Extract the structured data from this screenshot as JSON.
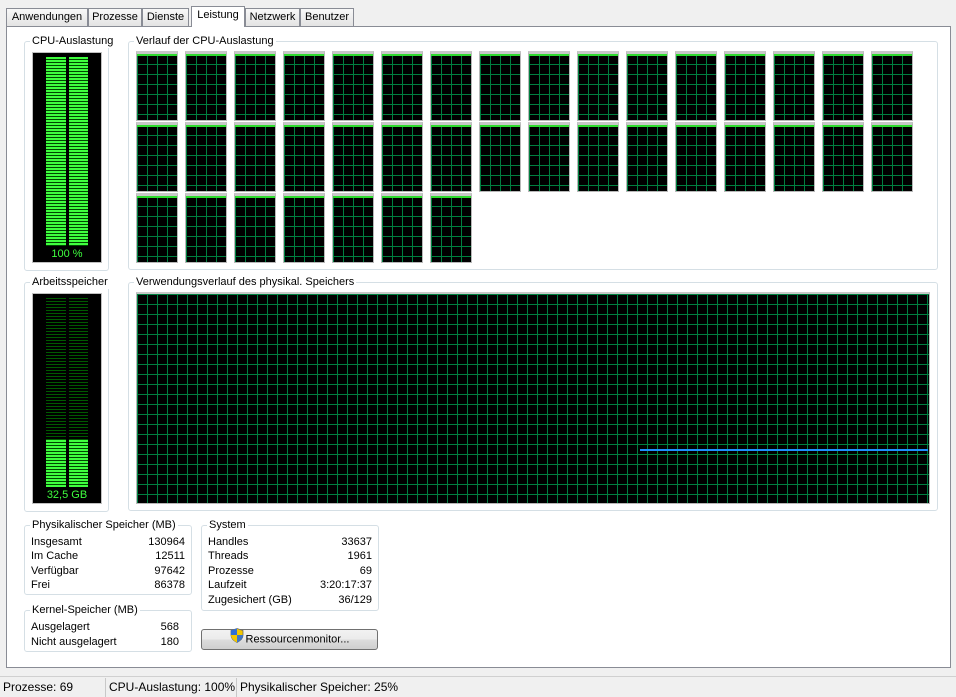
{
  "tabs": [
    "Anwendungen",
    "Prozesse",
    "Dienste",
    "Leistung",
    "Netzwerk",
    "Benutzer"
  ],
  "active_tab": "Leistung",
  "cpu": {
    "title": "CPU-Auslastung",
    "meter_label": "100 %",
    "meter_fill_percent": 100,
    "history_title": "Verlauf der CPU-Auslastung",
    "core_count": 39,
    "line_color": "#2fdc2f"
  },
  "memory": {
    "title": "Arbeitsspeicher",
    "meter_label": "32,5 GB",
    "meter_fill_percent": 25,
    "history_title": "Verwendungsverlauf des physikal. Speichers",
    "line_color": "#1e90ff"
  },
  "physical_memory": {
    "title": "Physikalischer Speicher (MB)",
    "rows": [
      {
        "label": "Insgesamt",
        "value": "130964"
      },
      {
        "label": "Im Cache",
        "value": "12511"
      },
      {
        "label": "Verfügbar",
        "value": "97642"
      },
      {
        "label": "Frei",
        "value": "86378"
      }
    ]
  },
  "kernel_memory": {
    "title": "Kernel-Speicher (MB)",
    "rows": [
      {
        "label": "Ausgelagert",
        "value": "568"
      },
      {
        "label": "Nicht ausgelagert",
        "value": "180"
      }
    ]
  },
  "system": {
    "title": "System",
    "rows": [
      {
        "label": "Handles",
        "value": "33637"
      },
      {
        "label": "Threads",
        "value": "1961"
      },
      {
        "label": "Prozesse",
        "value": "69"
      },
      {
        "label": "Laufzeit",
        "value": "3:20:17:37"
      },
      {
        "label": "Zugesichert (GB)",
        "value": "36/129"
      }
    ]
  },
  "resource_monitor_button": "Ressourcenmonitor...",
  "statusbar": {
    "processes": "Prozesse: 69",
    "cpu": "CPU-Auslastung: 100%",
    "memory": "Physikalischer Speicher: 25%"
  },
  "colors": {
    "meter_green": "#3fff3f",
    "grid_green": "#008040",
    "graph_bg": "#000000"
  }
}
